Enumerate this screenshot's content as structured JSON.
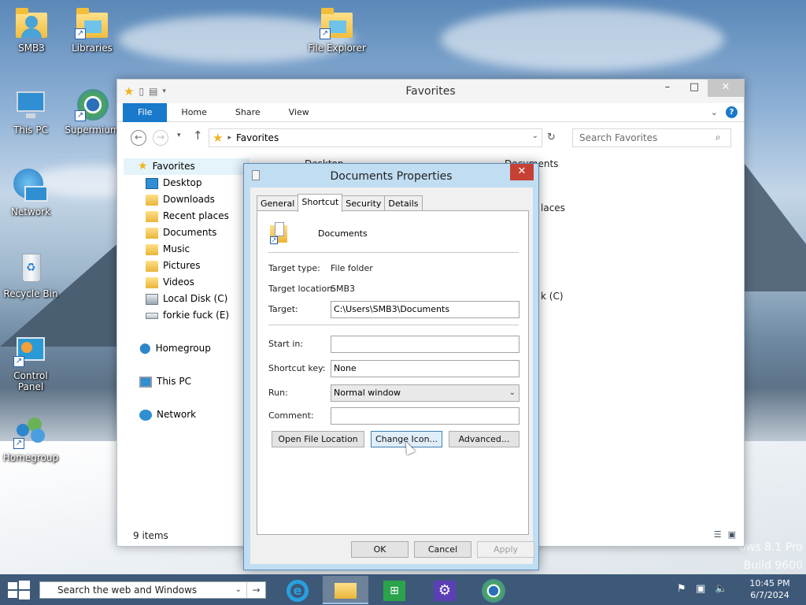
{
  "desktop": {
    "icons": [
      {
        "label": "SMB3"
      },
      {
        "label": "Libraries"
      },
      {
        "label": "File Explorer"
      },
      {
        "label": "This PC"
      },
      {
        "label": "Supermium"
      },
      {
        "label": "Network"
      },
      {
        "label": "Recycle Bin"
      },
      {
        "label": "Control Panel"
      },
      {
        "label": "Homegroup"
      }
    ],
    "watermark": [
      "ows 8.1 Pro",
      "Build 9600"
    ]
  },
  "explorer": {
    "title": "Favorites",
    "tabs": [
      "File",
      "Home",
      "Share",
      "View"
    ],
    "address": "Favorites",
    "search_placeholder": "Search Favorites",
    "nav": {
      "favorites": "Favorites",
      "items": [
        "Desktop",
        "Downloads",
        "Recent places",
        "Documents",
        "Music",
        "Pictures",
        "Videos",
        "Local Disk (C)",
        "forkie fuck (E)"
      ],
      "homegroup": "Homegroup",
      "this_pc": "This PC",
      "network": "Network"
    },
    "content": [
      "Desktop",
      "Documents",
      "laces",
      "k (C)"
    ],
    "status": "9 items"
  },
  "dialog": {
    "title": "Documents Properties",
    "tabs": [
      "General",
      "Shortcut",
      "Security",
      "Details"
    ],
    "name": "Documents",
    "target_type_label": "Target type:",
    "target_type": "File folder",
    "target_location_label": "Target location:",
    "target_location": "SMB3",
    "target_label": "Target:",
    "target": "C:\\Users\\SMB3\\Documents",
    "start_in_label": "Start in:",
    "start_in": "",
    "shortcut_key_label": "Shortcut key:",
    "shortcut_key": "None",
    "run_label": "Run:",
    "run": "Normal window",
    "comment_label": "Comment:",
    "comment": "",
    "buttons": {
      "open_location": "Open File Location",
      "change_icon": "Change Icon...",
      "advanced": "Advanced...",
      "ok": "OK",
      "cancel": "Cancel",
      "apply": "Apply"
    }
  },
  "taskbar": {
    "search": "Search the web and Windows",
    "time": "10:45 PM",
    "date": "6/7/2024"
  }
}
